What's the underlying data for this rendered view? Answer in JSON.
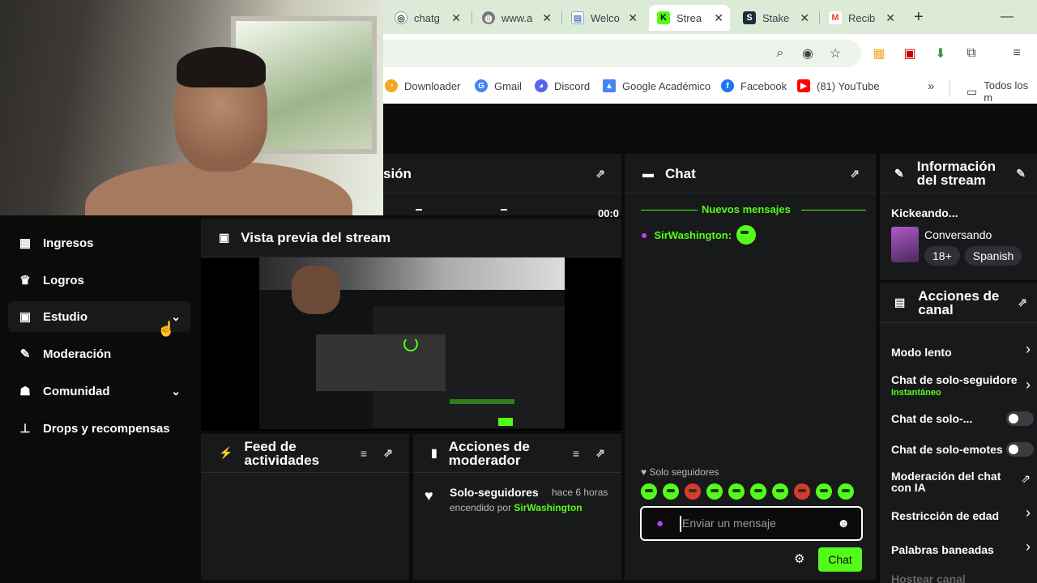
{
  "browser": {
    "tabs": [
      {
        "label": "chatg",
        "icon": "chatgpt-icon",
        "active": false
      },
      {
        "label": "www.a",
        "icon": "globe-icon",
        "active": false
      },
      {
        "label": "Welco",
        "icon": "document-icon",
        "active": false
      },
      {
        "label": "Strea",
        "icon": "kick-icon",
        "active": true
      },
      {
        "label": "Stake",
        "icon": "stake-icon",
        "active": false
      },
      {
        "label": "Recib",
        "icon": "gmail-icon",
        "active": false
      }
    ],
    "new_tab": "+",
    "bookmarks": [
      {
        "label": "Downloader",
        "color": "#f5a623"
      },
      {
        "label": "Gmail",
        "color": "#4285f4"
      },
      {
        "label": "Discord",
        "color": "#5865f2"
      },
      {
        "label": "Google Académico",
        "color": "#4285f4"
      },
      {
        "label": "Facebook",
        "color": "#1877f2"
      },
      {
        "label": "(81) YouTube",
        "color": "#ff0000"
      }
    ],
    "bookmarks_more": "»",
    "all_bookmarks": "Todos los m"
  },
  "sidebar": {
    "items": [
      {
        "label": "Ingresos",
        "icon": "chart-icon",
        "chevron": false
      },
      {
        "label": "Logros",
        "icon": "trophy-icon",
        "chevron": false
      },
      {
        "label": "Estudio",
        "icon": "studio-icon",
        "chevron": true
      },
      {
        "label": "Moderación",
        "icon": "wrench-icon",
        "chevron": false
      },
      {
        "label": "Comunidad",
        "icon": "community-icon",
        "chevron": true
      },
      {
        "label": "Drops y recompensas",
        "icon": "drops-icon",
        "chevron": false
      }
    ]
  },
  "session_panel": {
    "title": "sión",
    "time": "00:0"
  },
  "preview_panel": {
    "title": "Vista previa del stream"
  },
  "feed_panel": {
    "title_line1": "Feed de",
    "title_line2": "actividades"
  },
  "modactions_panel": {
    "title_line1": "Acciones de",
    "title_line2": "moderador",
    "entry": {
      "title": "Solo-seguidores",
      "time": "hace 6 horas",
      "by_prefix": "encendido por",
      "user": "SirWashington"
    }
  },
  "chat_panel": {
    "title": "Chat",
    "new_messages": "Nuevos mensajes",
    "message": {
      "user": "SirWashington:"
    },
    "followers_only": "Solo seguidores",
    "input_placeholder": "Enviar un mensaje",
    "send_label": "Chat"
  },
  "stream_info": {
    "title_line1": "Información",
    "title_line2": "del stream",
    "stream_title": "Kickeando...",
    "category": "Conversando",
    "tags": [
      "18+",
      "Spanish"
    ]
  },
  "channel_actions": {
    "title_line1": "Acciones de",
    "title_line2": "canal",
    "items": [
      {
        "label": "Modo lento",
        "type": "arrow"
      },
      {
        "label": "Chat de solo-seguidore",
        "sub": "Instantáneo",
        "type": "arrow"
      },
      {
        "label": "Chat de solo-...",
        "type": "toggle"
      },
      {
        "label": "Chat de solo-emotes",
        "type": "toggle"
      },
      {
        "label": "Moderación del chat con IA",
        "type": "external"
      },
      {
        "label": "Restricción de edad",
        "type": "arrow"
      },
      {
        "label": "Palabras baneadas",
        "type": "arrow"
      },
      {
        "label": "Hostear canal",
        "type": "arrow"
      }
    ]
  },
  "colors": {
    "accent": "#53fc18",
    "panel": "#18191b",
    "bg": "#0b0b0c"
  }
}
